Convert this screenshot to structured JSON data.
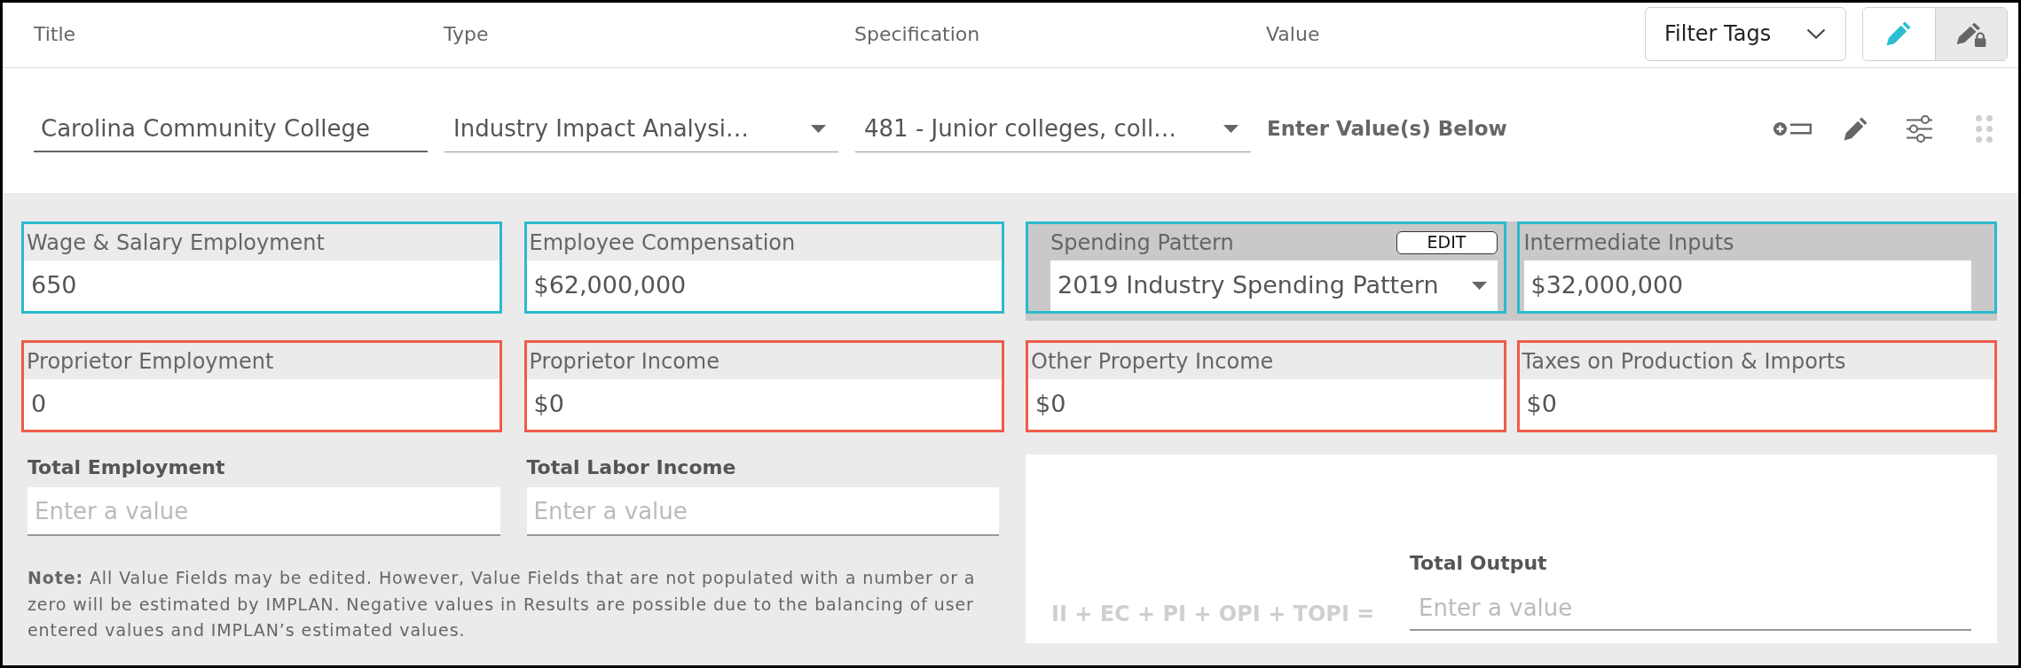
{
  "header": {
    "columns": [
      "Title",
      "Type",
      "Specification",
      "Value"
    ],
    "filter": {
      "label": "Filter Tags"
    },
    "mode_toggle": [
      {
        "kind": "edit",
        "selected": true
      },
      {
        "kind": "locked",
        "selected": false
      }
    ]
  },
  "entry": {
    "title": {
      "value": "Carolina Community College"
    },
    "type": {
      "value": "Industry Impact Analysi…"
    },
    "specification": {
      "value": "481 - Junior colleges, coll…"
    },
    "value_hint": "Enter Value(s) Below"
  },
  "field_groups": [
    {
      "shaded": false,
      "fields": [
        {
          "kind": "input",
          "label": "Wage & Salary Employment",
          "value": "650",
          "color": "#2bbacd"
        },
        {
          "kind": "input",
          "label": "Employee Compensation",
          "value": "$62,000,000",
          "color": "#2bbacd"
        }
      ]
    },
    {
      "shaded": true,
      "fields": [
        {
          "kind": "select",
          "label": "Spending Pattern",
          "value": "2019 Industry Spending Pattern",
          "action": "EDIT",
          "color": "#2bbacd"
        },
        {
          "kind": "input",
          "label": "Intermediate Inputs",
          "value": "$32,000,000",
          "color": "#2bbacd"
        }
      ]
    },
    {
      "shaded": false,
      "fields": [
        {
          "kind": "input",
          "label": "Proprietor Employment",
          "value": "0",
          "color": "#ee5c4a"
        },
        {
          "kind": "input",
          "label": "Proprietor Income",
          "value": "$0",
          "color": "#ee5c4a"
        }
      ]
    },
    {
      "shaded": false,
      "fields": [
        {
          "kind": "input",
          "label": "Other Property Income",
          "value": "$0",
          "color": "#ee5c4a"
        },
        {
          "kind": "input",
          "label": "Taxes on Production & Imports",
          "value": "$0",
          "color": "#ee5c4a"
        }
      ]
    }
  ],
  "totals": [
    {
      "label": "Total Employment",
      "placeholder": "Enter a value"
    },
    {
      "label": "Total Labor Income",
      "placeholder": "Enter a value"
    }
  ],
  "note": "**Note:** All Value Fields may be edited. However, Value Fields that are not populated with a number or a zero will be estimated by IMPLAN. Negative values in Results are possible due to the balancing of user entered values and IMPLAN’s estimated values.",
  "total_output": {
    "formula": "II + EC + PI + OPI + TOPI =",
    "label": "Total Output",
    "placeholder": "Enter a value"
  }
}
